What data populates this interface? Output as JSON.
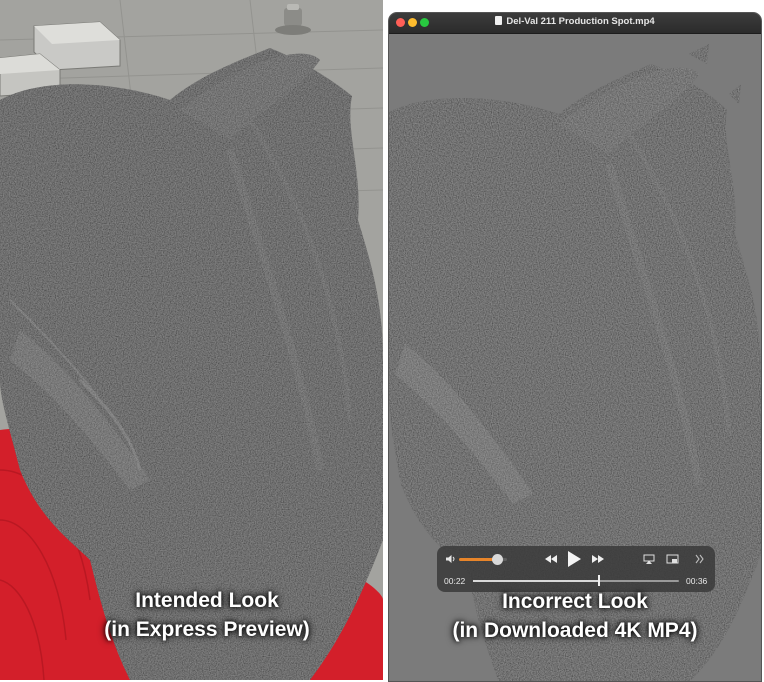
{
  "left_panel": {
    "caption_line1": "Intended Look",
    "caption_line2": "(in Express Preview)"
  },
  "player_window": {
    "title": "Del-Val 211 Production Spot.mp4",
    "caption_line1": "Incorrect Look",
    "caption_line2": "(in Downloaded 4K MP4)",
    "controls": {
      "current_time": "00:22",
      "total_time": "00:36",
      "progress": 0.61,
      "volume": 0.8
    }
  },
  "colors": {
    "accent_red": "#d31f2a",
    "volume_accent": "#e8852a",
    "player_background": "#7b7b7b",
    "paint_texture": "#2c2c2c"
  },
  "icons": [
    "volume-icon",
    "rewind-icon",
    "play-icon",
    "fast-forward-icon",
    "airplay-icon",
    "picture-in-picture-icon",
    "more-icon"
  ]
}
